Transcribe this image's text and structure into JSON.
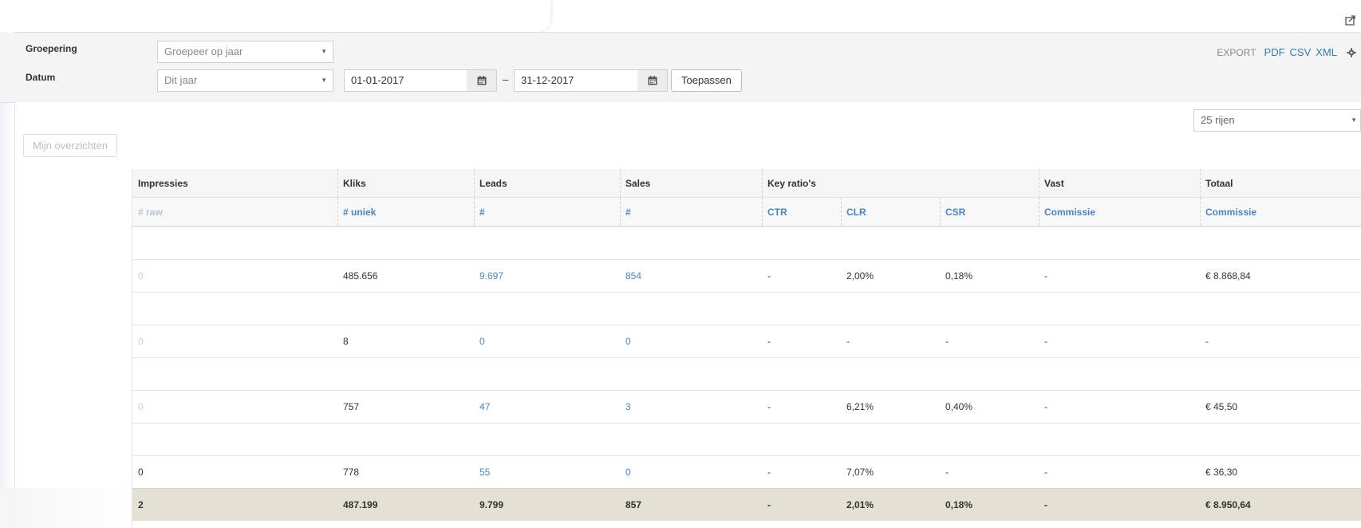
{
  "toolbar": {
    "share_icon": "share-icon"
  },
  "filters": {
    "grouping_label": "Groepering",
    "grouping_value": "Groepeer op jaar",
    "date_label": "Datum",
    "date_preset": "Dit jaar",
    "date_from": "01-01-2017",
    "date_separator": "–",
    "date_to": "31-12-2017",
    "apply_label": "Toepassen"
  },
  "export": {
    "label": "EXPORT",
    "pdf": "PDF",
    "csv": "CSV",
    "xml": "XML",
    "settings_icon": "gear-icon"
  },
  "panel": {
    "rows_select": "25 rijen",
    "overview_button": "Mijn overzichten"
  },
  "table": {
    "groups": [
      "Impressies",
      "Kliks",
      "Leads",
      "Sales",
      "Key ratio's",
      "Vast",
      "Totaal"
    ],
    "subheaders": [
      "# raw",
      "# uniek",
      "#",
      "#",
      "CTR",
      "CLR",
      "CSR",
      "Commissie",
      "Commissie"
    ],
    "rows": [
      [
        "0",
        "485.656",
        "9.697",
        "854",
        "-",
        "2,00%",
        "0,18%",
        "-",
        "€ 8.868,84"
      ],
      [
        "0",
        "8",
        "0",
        "0",
        "-",
        "-",
        "-",
        "-",
        "-"
      ],
      [
        "0",
        "757",
        "47",
        "3",
        "-",
        "6,21%",
        "0,40%",
        "-",
        "€ 45,50"
      ],
      [
        "0",
        "778",
        "55",
        "0",
        "-",
        "7,07%",
        "-",
        "-",
        "€ 36,30"
      ]
    ],
    "total": [
      "2",
      "487.199",
      "9.799",
      "857",
      "-",
      "2,01%",
      "0,18%",
      "-",
      "€ 8.950,64"
    ]
  },
  "colors": {
    "link": "#4a86c5",
    "total_row": "#e2e1d3"
  }
}
